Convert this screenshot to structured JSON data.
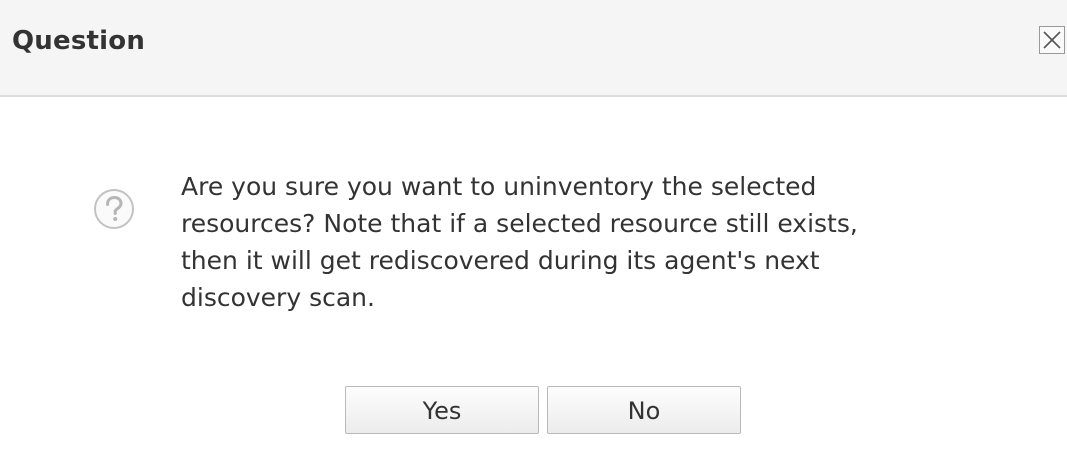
{
  "dialog": {
    "title": "Question",
    "close_icon": "close-icon",
    "question_icon": "question-mark-icon",
    "message": "Are you sure you want to uninventory the selected resources? Note that if a selected resource still exists, then it will get rediscovered during its agent's next discovery scan.",
    "buttons": {
      "yes_label": "Yes",
      "no_label": "No"
    }
  },
  "colors": {
    "header_background": "#f5f5f5",
    "header_divider": "#dcdcdc",
    "text": "#333333",
    "icon": "#c2c2c2",
    "button_border": "#b9b9b9"
  }
}
